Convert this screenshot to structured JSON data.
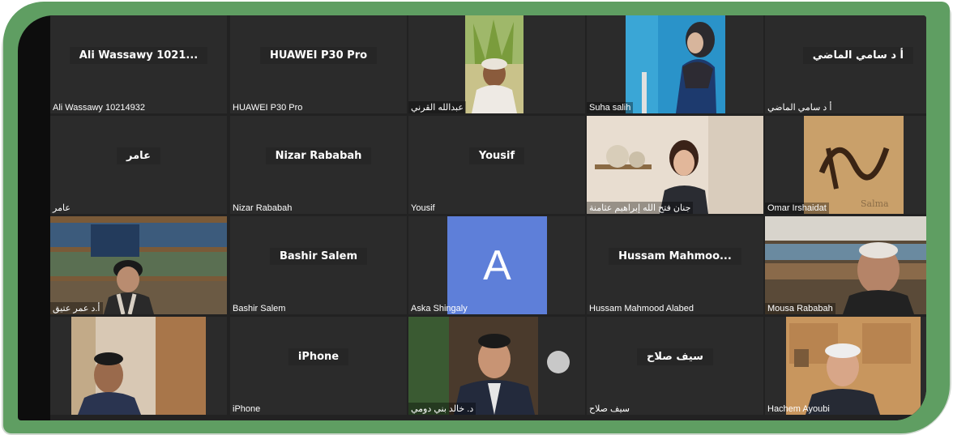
{
  "meeting": {
    "id_fragment": "5790"
  },
  "participants": [
    {
      "name": "Ali Wassawy 10214932",
      "display": "Ali Wassawy 1021...",
      "type": "name"
    },
    {
      "name": "HUAWEI P30 Pro",
      "display": "HUAWEI P30 Pro",
      "type": "name"
    },
    {
      "name": "عبدالله القرني",
      "type": "video"
    },
    {
      "name": "Suha salih",
      "type": "video"
    },
    {
      "name": "أ د سامي الماضي",
      "display": "أ د سامي الماضي",
      "type": "name"
    },
    {
      "name": "عامر",
      "display": "عامر",
      "type": "name"
    },
    {
      "name": "Nizar Rababah",
      "display": "Nizar Rababah",
      "type": "name"
    },
    {
      "name": "Yousif",
      "display": "Yousif",
      "type": "name"
    },
    {
      "name": "جنان فتح الله إبراهيم عثامنة",
      "type": "video"
    },
    {
      "name": "Omar Irshaidat",
      "type": "video",
      "image_text": "Salma"
    },
    {
      "name": "أ.د عمر عتيق",
      "type": "video"
    },
    {
      "name": "Bashir Salem",
      "display": "Bashir Salem",
      "type": "name"
    },
    {
      "name": "Aska Shingaly",
      "type": "avatar",
      "initial": "A",
      "avatar_color": "#5e7fd9"
    },
    {
      "name": "Hussam Mahmood Alabed",
      "display": "Hussam  Mahmoo...",
      "type": "name"
    },
    {
      "name": "Mousa Rababah",
      "type": "video"
    },
    {
      "name": "",
      "type": "video"
    },
    {
      "name": "iPhone",
      "display": "iPhone",
      "type": "name"
    },
    {
      "name": "د. خالد بني دومي",
      "type": "video"
    },
    {
      "name": "سيف صلاح",
      "display": "سيف صلاح",
      "type": "name"
    },
    {
      "name": "Hachem  Ayoubi",
      "type": "video"
    }
  ],
  "colors": {
    "frame": "#5f9e62",
    "tile": "#2b2b2b",
    "background": "#0d0d0d"
  }
}
